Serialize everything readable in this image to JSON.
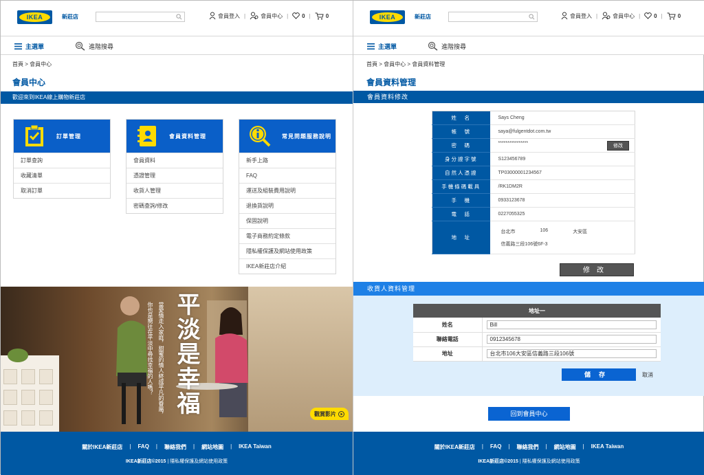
{
  "header": {
    "logo": "IKEA",
    "store": "新莊店",
    "login": "會員登入",
    "member": "會員中心",
    "wish_count": "0",
    "cart_count": "0"
  },
  "subnav": {
    "menu": "主選單",
    "advanced": "進階搜尋"
  },
  "left": {
    "breadcrumb": "首頁 > 會員中心",
    "title": "會員中心",
    "welcome": "歡迎來到IKEA線上購物新莊店",
    "cards": [
      {
        "title": "訂單管理",
        "icon": "clipboard-icon",
        "items": [
          "訂單查詢",
          "收藏清單",
          "取消訂單"
        ]
      },
      {
        "title": "會員資料管理",
        "icon": "contacts-icon",
        "items": [
          "會員資料",
          "憑證管理",
          "收貨人管理",
          "密碼查詢/修改"
        ]
      },
      {
        "title": "常見問題服務說明",
        "icon": "info-icon",
        "items": [
          "新手上路",
          "FAQ",
          "運送及組裝費用說明",
          "退換貨說明",
          "保固說明",
          "電子商務約定條款",
          "隱私權保護及網站使用政策",
          "IKEA新莊店介紹"
        ]
      }
    ],
    "banner": {
      "title": "平淡是幸福",
      "sub1": "當愛情走入家庭，甜蜜的情人終成平凡的眷屬，",
      "sub2": "你也是嚮往在平淡中尋找幸福的人嗎？",
      "video": "觀賞影片"
    }
  },
  "right": {
    "breadcrumb": "首頁 > 會員中心 > 會員資料管理",
    "title": "會員資料管理",
    "section1": "會員資料修改",
    "fields": [
      {
        "label": "姓　名",
        "value": "Says Cheng"
      },
      {
        "label": "帳　號",
        "value": "saya@fulgentdot.com.tw"
      },
      {
        "label": "密　碼",
        "value": "****************"
      },
      {
        "label": "身分證字號",
        "value": "S123456789"
      },
      {
        "label": "自然人憑證",
        "value": "TP03000001234567"
      },
      {
        "label": "手機條碼載具",
        "value": "/RK1DM2R"
      },
      {
        "label": "手　機",
        "value": "0933123678"
      },
      {
        "label": "電　話",
        "value": "0227055325"
      }
    ],
    "address_label": "地　址",
    "address_city": "台北市",
    "address_zip": "106",
    "address_district": "大安區",
    "address_street": "信義路三段106號6F-3",
    "edit_small": "修改",
    "edit_big": "修改",
    "section2": "收貨人資料管理",
    "receiver_header": "地址一",
    "receiver": [
      {
        "label": "姓名",
        "value": "Bill"
      },
      {
        "label": "聯絡電話",
        "value": "0912345678"
      },
      {
        "label": "地址",
        "value": "台北市106大安區信義路三段106號"
      }
    ],
    "save": "儲存",
    "cancel": "取消",
    "back": "回到會員中心"
  },
  "footer": {
    "links": [
      "關於IKEA新莊店",
      "FAQ",
      "聯絡我們",
      "網站地圖",
      "IKEA Taiwan"
    ],
    "copyright": "IKEA新莊店©2015",
    "privacy": "隱私權保護及網站使用政策"
  },
  "colors": {
    "brand_blue": "#0058a3",
    "brand_yellow": "#ffdb00"
  }
}
